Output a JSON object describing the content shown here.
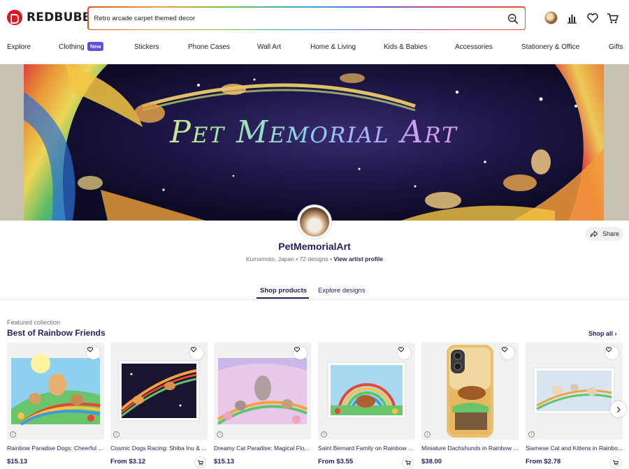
{
  "brand": {
    "name": "REDBUBBLE",
    "color": "#e41321"
  },
  "search": {
    "value": "Retro arcade carpet themed decor",
    "placeholder": ""
  },
  "header_icons": [
    "avatar",
    "chart-icon",
    "heart-icon",
    "cart-icon"
  ],
  "nav": {
    "items": [
      "Explore",
      "Clothing",
      "Stickers",
      "Phone Cases",
      "Wall Art",
      "Home & Living",
      "Kids & Babies",
      "Accessories",
      "Stationery & Office",
      "Gifts"
    ],
    "clothing_badge": "New"
  },
  "banner": {
    "title": "Pet Memorial Art"
  },
  "artist": {
    "name": "PetMemorialArt",
    "location": "Kumamoto, Japan",
    "designs": "72 designs",
    "profile_link": "View artist profile"
  },
  "share": {
    "label": "Share"
  },
  "tabs": {
    "shop": "Shop products",
    "explore": "Explore designs",
    "active": "Shop products"
  },
  "collection": {
    "kicker": "Featured collection",
    "title": "Best of Rainbow Friends",
    "shop_all": "Shop all",
    "products": [
      {
        "title": "Rainbow Paradise Dogs: Cheerful ...",
        "price": "$15.13",
        "cart": false
      },
      {
        "title": "Cosmic Dogs Racing: Shiba Inu & ...",
        "price": "From $3.12",
        "cart": true
      },
      {
        "title": "Dreamy Cat Paradise: Magical Flo...",
        "price": "$15.13",
        "cart": false
      },
      {
        "title": "Saint Bernard Family on Rainbow F...",
        "price": "From $3.55",
        "cart": true
      },
      {
        "title": "Miniature Dachshunds in Rainbow ...",
        "price": "$38.00",
        "cart": false
      },
      {
        "title": "Siamese Cat and Kittens in Rainbo...",
        "price": "From $2.78",
        "cart": true
      }
    ]
  },
  "colors": {
    "accent": "#5a52d9",
    "text_dark": "#1f1f5a"
  }
}
